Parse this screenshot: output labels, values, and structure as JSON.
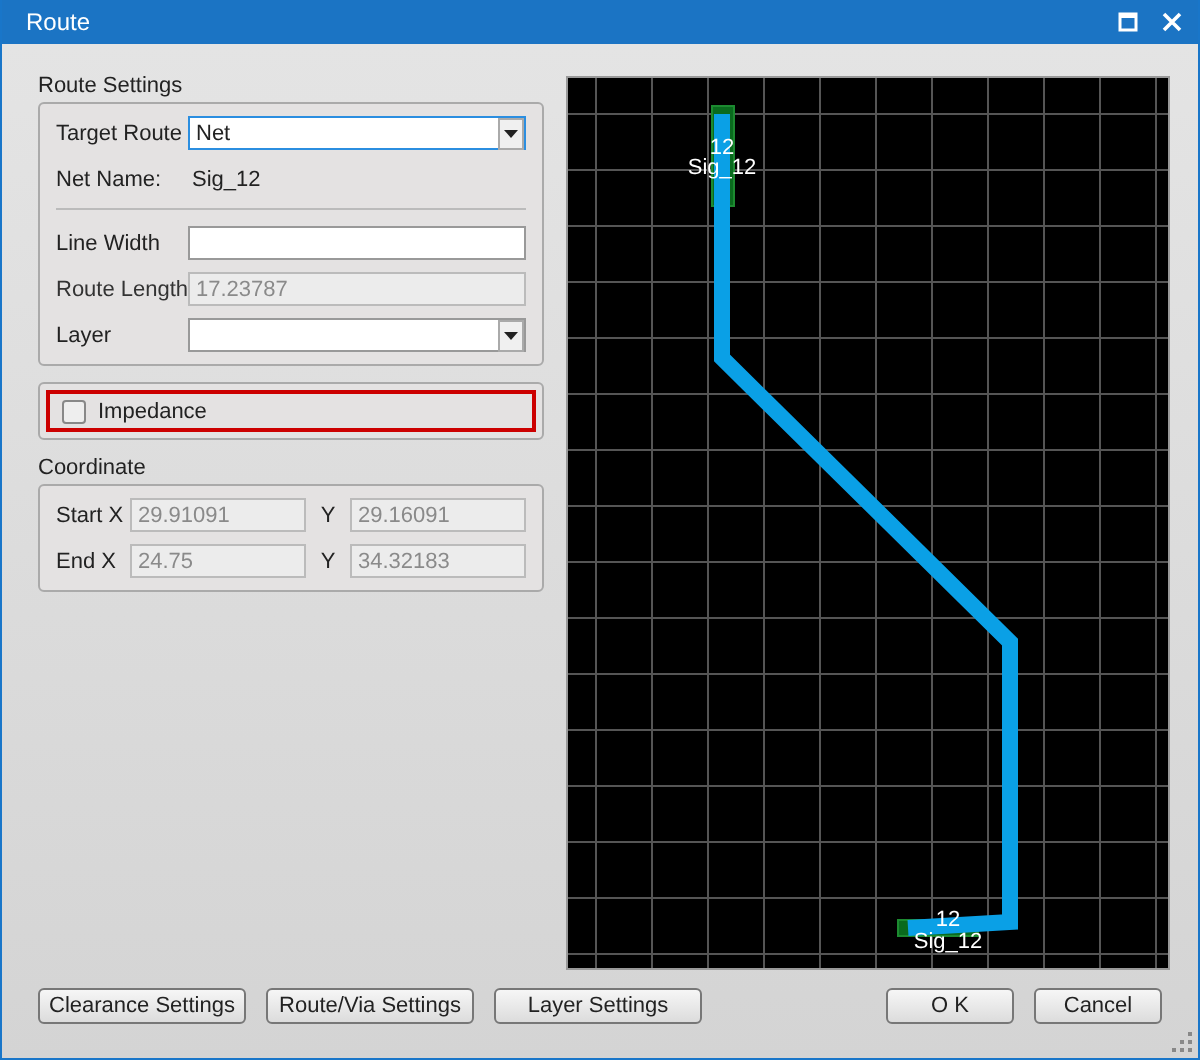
{
  "window": {
    "title": "Route"
  },
  "route_settings": {
    "title": "Route Settings",
    "target_route": {
      "label": "Target Route",
      "value": "Net",
      "focused": true
    },
    "net_name": {
      "label": "Net Name:",
      "value": "Sig_12"
    },
    "fields": [
      {
        "kind": "text",
        "label": "Line Width",
        "disabled": false
      },
      {
        "kind": "text",
        "label": "Route Length",
        "value": "17.23787",
        "disabled": true
      },
      {
        "kind": "combo",
        "label": "Layer",
        "disabled": false
      }
    ]
  },
  "impedance": {
    "label": "Impedance",
    "checked": false,
    "highlighted": true
  },
  "coordinate": {
    "title": "Coordinate",
    "rows": [
      {
        "label": "Start X",
        "x": {
          "value": "29.91091",
          "disabled": true
        },
        "y_label": "Y",
        "y": {
          "value": "29.16091",
          "disabled": true
        }
      },
      {
        "label": "End X",
        "x": {
          "value": "24.75",
          "disabled": true
        },
        "y_label": "Y",
        "y": {
          "value": "34.32183",
          "disabled": true
        }
      }
    ]
  },
  "canvas": {
    "pads": [
      {
        "number": "12",
        "net": "Sig_12"
      },
      {
        "number": "12",
        "net": "Sig_12"
      }
    ]
  },
  "buttons": [
    {
      "label": "Clearance Settings"
    },
    {
      "label": "Route/Via Settings"
    },
    {
      "label": "Layer Settings"
    }
  ],
  "dialog_buttons": [
    {
      "label": "O K"
    },
    {
      "label": "Cancel"
    }
  ]
}
